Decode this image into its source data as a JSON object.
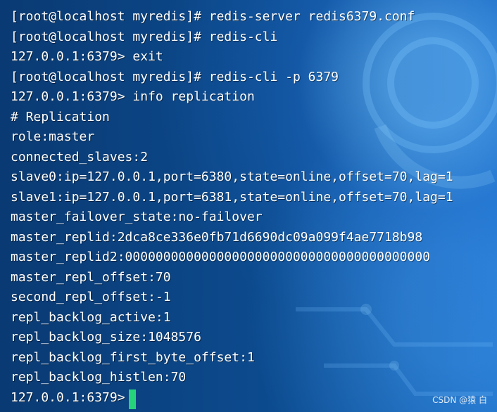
{
  "terminal": {
    "lines": [
      "[root@localhost myredis]# redis-server redis6379.conf",
      "[root@localhost myredis]# redis-cli",
      "127.0.0.1:6379> exit",
      "[root@localhost myredis]# redis-cli -p 6379",
      "127.0.0.1:6379> info replication",
      "# Replication",
      "role:master",
      "connected_slaves:2",
      "slave0:ip=127.0.0.1,port=6380,state=online,offset=70,lag=1",
      "slave1:ip=127.0.0.1,port=6381,state=online,offset=70,lag=1",
      "master_failover_state:no-failover",
      "master_replid:2dca8ce336e0fb71d6690dc09a099f4ae7718b98",
      "master_replid2:0000000000000000000000000000000000000000",
      "master_repl_offset:70",
      "second_repl_offset:-1",
      "repl_backlog_active:1",
      "repl_backlog_size:1048576",
      "repl_backlog_first_byte_offset:1",
      "repl_backlog_histlen:70",
      "127.0.0.1:6379> "
    ],
    "cursor_color": "#27d37a"
  },
  "watermark": "CSDN @猿 白"
}
